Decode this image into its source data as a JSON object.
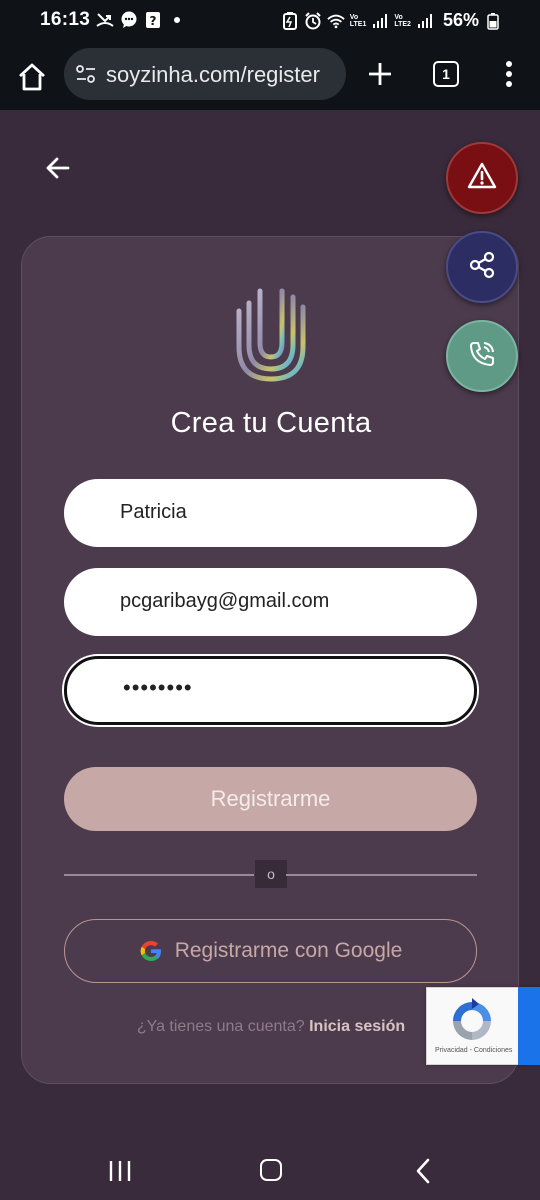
{
  "status_bar": {
    "time": "16:13",
    "battery": "56%",
    "sim1_label": "Vo\nLTE1",
    "sim2_label": "Vo\nLTE2"
  },
  "browser": {
    "url": "soyzinha.com/register",
    "tab_count": "1"
  },
  "page": {
    "title": "Crea tu Cuenta",
    "fields": {
      "name_value": "Patricia",
      "email_value": "pcgaribayg@gmail.com",
      "password_value": "••••••••"
    },
    "register_button": "Registrarme",
    "divider_label": "o",
    "google_button": "Registrarme con Google",
    "login_prompt": "¿Ya tienes una cuenta?",
    "login_link": "Inicia sesión",
    "recaptcha_text": "Privacidad - Condiciones"
  },
  "colors": {
    "background": "#3a2b3c",
    "card": "#4c3b4d",
    "register_button": "#c6a8a6",
    "alert_fab": "#7a0f13",
    "share_fab": "#2b2d63",
    "call_fab": "#5f9a86"
  },
  "icons": {
    "back": "arrow-left-icon",
    "alert": "warning-triangle-icon",
    "share": "share-icon",
    "call": "phone-call-icon",
    "logo": "hand-logo",
    "google": "google-g-icon"
  }
}
